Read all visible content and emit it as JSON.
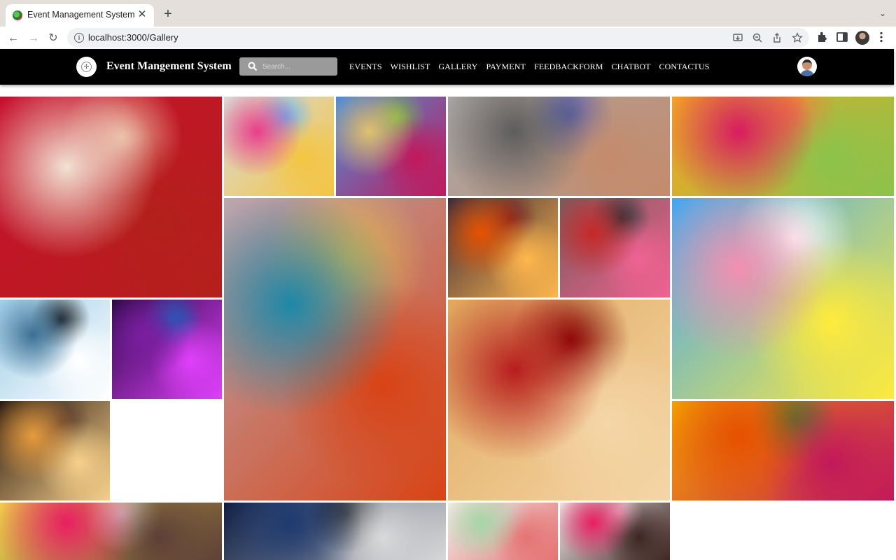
{
  "browser": {
    "tab_title": "Event Management System",
    "tab_close": "✕",
    "new_tab": "+",
    "url": "localhost:3000/Gallery",
    "back": "←",
    "forward": "→",
    "reload": "↻",
    "tab_menu": "⌄",
    "icons": [
      "install-icon",
      "zoom-icon",
      "share-icon",
      "bookmark-star-icon",
      "extensions-icon",
      "side-panel-icon",
      "profile-icon",
      "kebab-menu-icon"
    ]
  },
  "app": {
    "brand": "Event Mangement System",
    "search_placeholder": "Search...",
    "nav": [
      "EVENTS",
      "WISHLIST",
      "GALLERY",
      "PAYMENT",
      "FEEDBACKFORM",
      "CHATBOT",
      "CONTACTUS"
    ]
  },
  "gallery": {
    "tiles": [
      {
        "name": "photo-wedding-hands-garland",
        "colors": [
          "#c8102e",
          "#f2e2d2",
          "#b3201a",
          "#e9b49a"
        ]
      },
      {
        "name": "photo-kids-birthday-party",
        "colors": [
          "#d9d9d9",
          "#e83e8c",
          "#f4c542",
          "#64b5f6"
        ]
      },
      {
        "name": "photo-holi-crowd-temple",
        "colors": [
          "#4a90d9",
          "#e0c26a",
          "#c2185b",
          "#7cb342"
        ]
      },
      {
        "name": "photo-street-dance-crowd",
        "colors": [
          "#a8a8a8",
          "#5d5d5d",
          "#c48b6c",
          "#3f51b5"
        ]
      },
      {
        "name": "photo-holi-color-splash",
        "colors": [
          "#f5a623",
          "#d81b60",
          "#8bc34a",
          "#ff7043"
        ]
      },
      {
        "name": "photo-bride-blue-saree",
        "colors": [
          "#b9a7b0",
          "#1e88a8",
          "#d84315",
          "#e0b64a"
        ]
      },
      {
        "name": "photo-ganesh-festival",
        "colors": [
          "#3a2a3a",
          "#e65100",
          "#ffb74d",
          "#7b1f1f"
        ]
      },
      {
        "name": "photo-folk-dance-group",
        "colors": [
          "#7a5a5a",
          "#c62828",
          "#f06292",
          "#263238"
        ]
      },
      {
        "name": "photo-party-confetti-cake",
        "colors": [
          "#42a5f5",
          "#f48fb1",
          "#ffeb3b",
          "#ffffff"
        ]
      },
      {
        "name": "photo-couple-moon-sea",
        "colors": [
          "#9ecde8",
          "#3a6f93",
          "#ffffff",
          "#1a1a1a"
        ]
      },
      {
        "name": "photo-concert-purple-lights",
        "colors": [
          "#2a0845",
          "#7b1fa2",
          "#e040fb",
          "#1565c0"
        ]
      },
      {
        "name": "photo-henna-hands-closeup",
        "colors": [
          "#e0a95c",
          "#b71c1c",
          "#f5d6a8",
          "#7f0000"
        ]
      },
      {
        "name": "photo-friends-sparklers-night",
        "colors": [
          "#2b1a12",
          "#e69a3c",
          "#f7d08a",
          "#5a3a2a"
        ]
      },
      {
        "name": "photo-haldi-flower-backdrop",
        "colors": [
          "#f4a300",
          "#e65100",
          "#c2185b",
          "#2e7d32"
        ]
      },
      {
        "name": "photo-bride-yellow-saree",
        "colors": [
          "#f2d64b",
          "#e91e63",
          "#5d4037",
          "#ffffff"
        ]
      },
      {
        "name": "photo-night-sky-moon",
        "colors": [
          "#0d1b3d",
          "#1e3a70",
          "#d9d9d9",
          "#000000"
        ]
      },
      {
        "name": "photo-groom-white-kurta",
        "colors": [
          "#f0ede8",
          "#a5d6a7",
          "#e57373",
          "#d7ccc8"
        ]
      },
      {
        "name": "photo-woman-pink-saree",
        "colors": [
          "#efe6e6",
          "#e91e63",
          "#3e2723",
          "#f8bbd0"
        ]
      }
    ]
  }
}
